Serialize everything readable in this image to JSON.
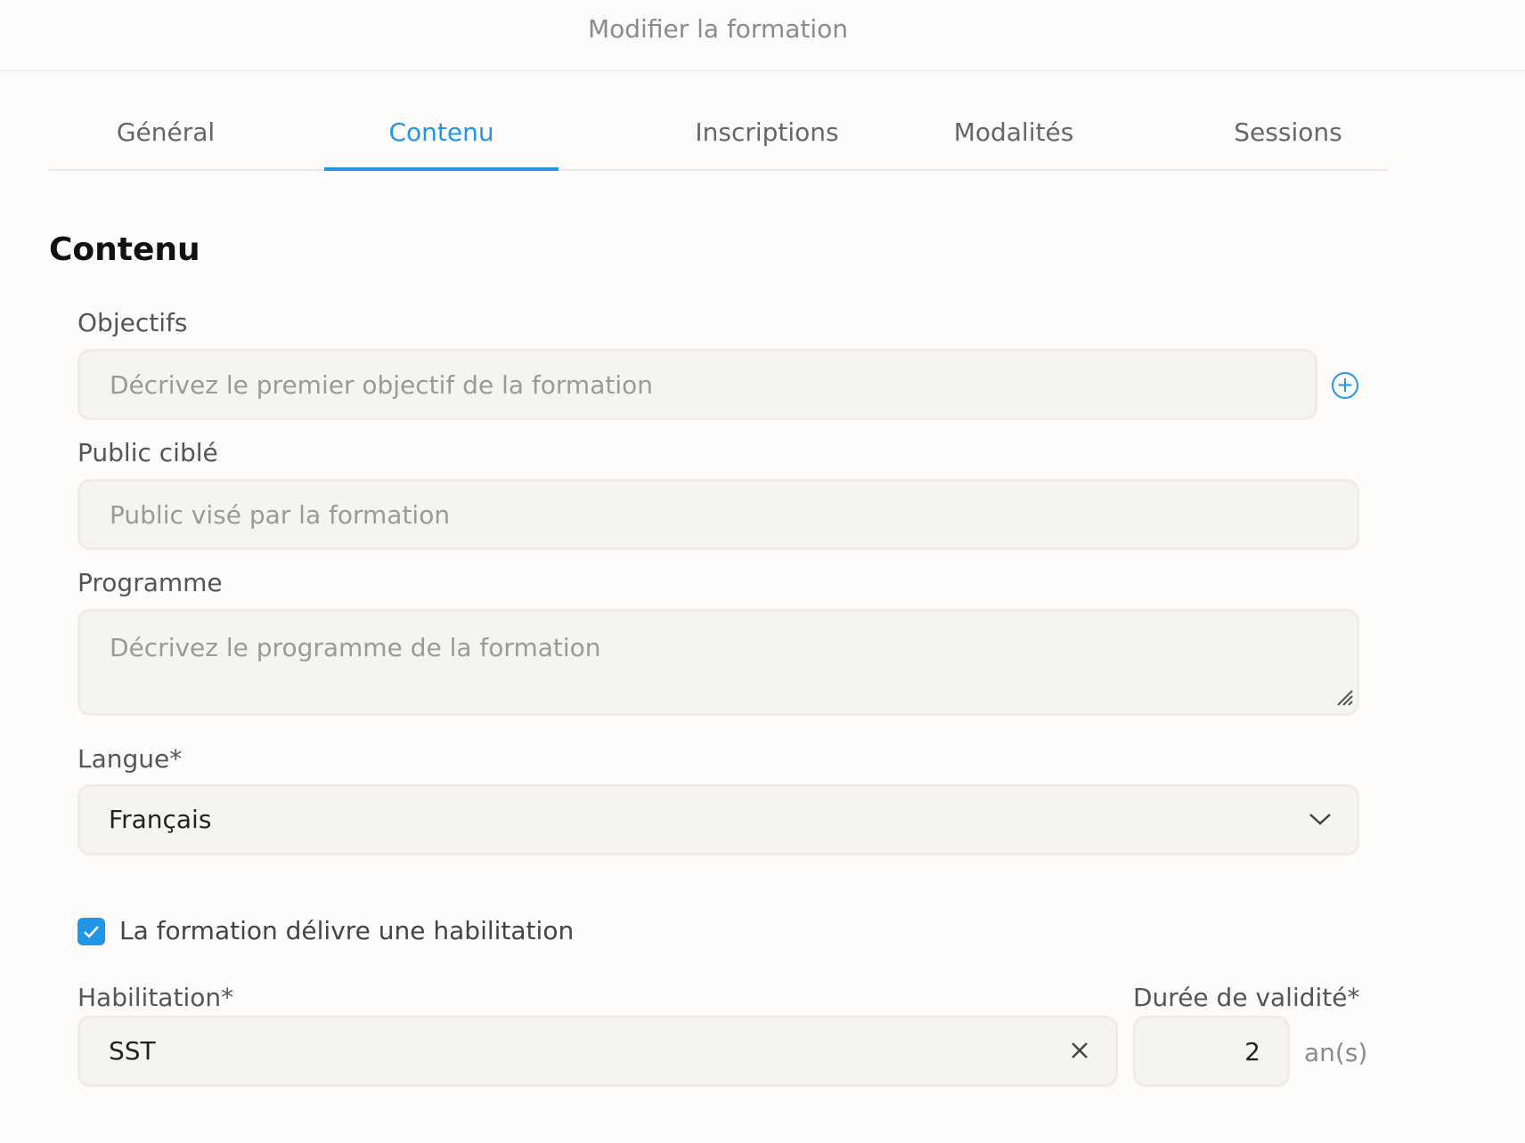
{
  "header": {
    "title": "Modifier la formation"
  },
  "tabs": [
    {
      "label": "Général"
    },
    {
      "label": "Contenu"
    },
    {
      "label": "Inscriptions"
    },
    {
      "label": "Modalités"
    },
    {
      "label": "Sessions"
    }
  ],
  "active_tab": "Contenu",
  "section": {
    "title": "Contenu"
  },
  "objectifs": {
    "label": "Objectifs",
    "value": "",
    "placeholder": "Décrivez le premier objectif de la formation"
  },
  "public": {
    "label": "Public ciblé",
    "value": "",
    "placeholder": "Public visé par la formation"
  },
  "programme": {
    "label": "Programme",
    "value": "",
    "placeholder": "Décrivez le programme de la formation"
  },
  "langue": {
    "label": "Langue*",
    "value": "Français"
  },
  "habilitation_toggle": {
    "label": "La formation délivre une habilitation",
    "checked": true
  },
  "habilitation": {
    "label": "Habilitation*",
    "value": "SST"
  },
  "duree": {
    "label": "Durée de validité*",
    "value": "2",
    "unit": "an(s)"
  },
  "colors": {
    "accent": "#2196e8",
    "field_bg": "#f6f4f1",
    "field_border": "#efece8"
  },
  "icons": {
    "add": "plus-circle-icon",
    "resize": "resize-handle-icon",
    "dropdown": "chevron-down-icon",
    "check": "check-icon",
    "clear": "close-icon"
  }
}
